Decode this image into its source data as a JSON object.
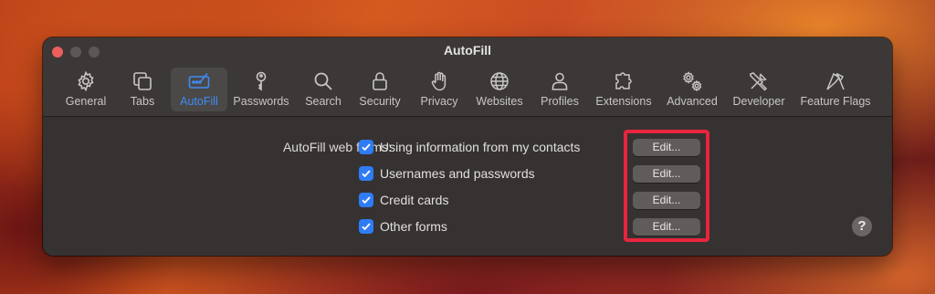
{
  "window": {
    "title": "AutoFill",
    "controls": [
      "close-icon",
      "minimize-icon",
      "zoom-icon"
    ]
  },
  "toolbar": {
    "active_tab": "AutoFill",
    "tabs": [
      {
        "label": "General",
        "icon": "gear-icon"
      },
      {
        "label": "Tabs",
        "icon": "tabs-icon"
      },
      {
        "label": "AutoFill",
        "icon": "autofill-icon"
      },
      {
        "label": "Passwords",
        "icon": "key-icon"
      },
      {
        "label": "Search",
        "icon": "search-icon"
      },
      {
        "label": "Security",
        "icon": "lock-icon"
      },
      {
        "label": "Privacy",
        "icon": "hand-icon"
      },
      {
        "label": "Websites",
        "icon": "globe-icon"
      },
      {
        "label": "Profiles",
        "icon": "person-icon"
      },
      {
        "label": "Extensions",
        "icon": "puzzle-icon"
      },
      {
        "label": "Advanced",
        "icon": "gears-icon"
      },
      {
        "label": "Developer",
        "icon": "tools-icon"
      },
      {
        "label": "Feature Flags",
        "icon": "flags-icon"
      }
    ]
  },
  "autofill": {
    "label": "AutoFill web forms:",
    "options": [
      {
        "label": "Using information from my contacts",
        "checked": true,
        "button": "Edit..."
      },
      {
        "label": "Usernames and passwords",
        "checked": true,
        "button": "Edit..."
      },
      {
        "label": "Credit cards",
        "checked": true,
        "button": "Edit..."
      },
      {
        "label": "Other forms",
        "checked": true,
        "button": "Edit..."
      }
    ]
  },
  "help_button": "?",
  "colors": {
    "accent": "#3e8df4",
    "checkbox": "#2f7cf6",
    "highlight": "#e8243f",
    "window_bg": "#353231",
    "close": "#ec5f5b"
  }
}
